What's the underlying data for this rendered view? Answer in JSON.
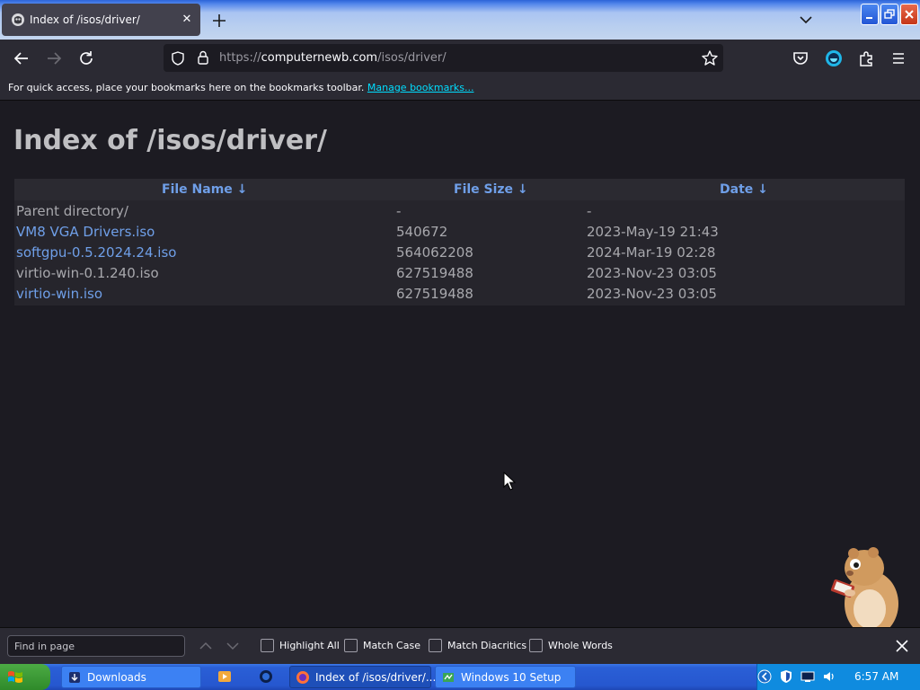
{
  "browser": {
    "tab_title": "Index of /isos/driver/",
    "url_prefix": "https://",
    "url_host": "computernewb.com",
    "url_path": "/isos/driver/"
  },
  "bookmarks_bar": {
    "message": "For quick access, place your bookmarks here on the bookmarks toolbar.",
    "manage_link": "Manage bookmarks..."
  },
  "page": {
    "title": "Index of /isos/driver/",
    "columns": {
      "name": "File Name  ↓",
      "size": "File Size  ↓",
      "date": "Date  ↓"
    },
    "rows": [
      {
        "name": "Parent directory/",
        "size": "-",
        "date": "-"
      },
      {
        "name": "VM8 VGA Drivers.iso",
        "size": "540672",
        "date": "2023-May-19 21:43"
      },
      {
        "name": "softgpu-0.5.2024.24.iso",
        "size": "564062208",
        "date": "2024-Mar-19 02:28"
      },
      {
        "name": "virtio-win-0.1.240.iso",
        "size": "627519488",
        "date": "2023-Nov-23 03:05"
      },
      {
        "name": "virtio-win.iso",
        "size": "627519488",
        "date": "2023-Nov-23 03:05"
      }
    ]
  },
  "findbar": {
    "placeholder": "Find in page",
    "options": [
      "Highlight All",
      "Match Case",
      "Match Diacritics",
      "Whole Words"
    ]
  },
  "taskbar": {
    "tasks": [
      "Downloads",
      "Index of /isos/driver/...",
      "Windows 10 Setup"
    ],
    "clock": "6:57 AM"
  },
  "colors": {
    "link": "#6f9fe8",
    "page_bg": "#1c1b22",
    "accent_link": "#00ddff"
  }
}
